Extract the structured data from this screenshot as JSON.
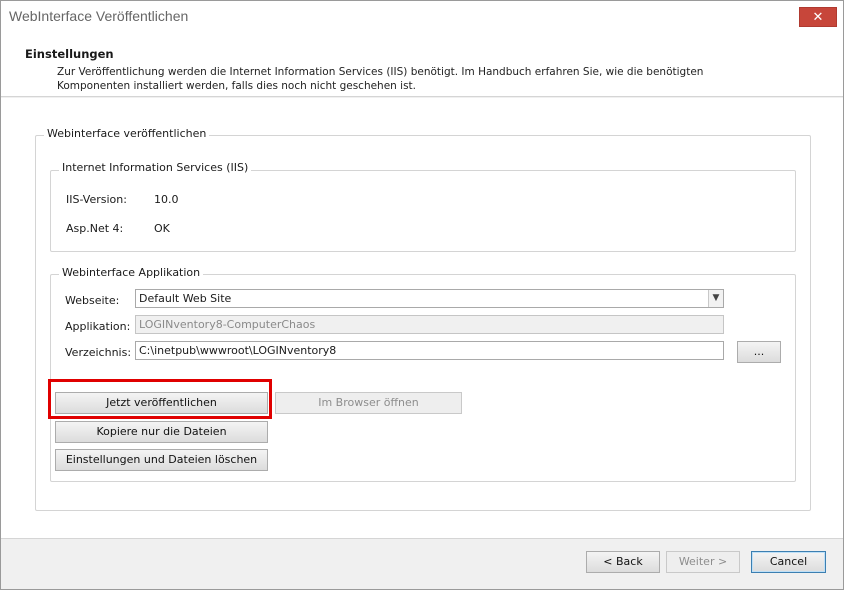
{
  "window": {
    "title": "WebInterface Veröffentlichen",
    "close_label": "✕"
  },
  "header": {
    "title": "Einstellungen",
    "description": "Zur Veröffentlichung werden die Internet Information Services (IIS) benötigt. Im Handbuch erfahren Sie, wie die benötigten Komponenten installiert werden, falls dies noch nicht geschehen ist."
  },
  "publish_group": {
    "legend": "Webinterface veröffentlichen",
    "iis": {
      "legend": "Internet Information Services (IIS)",
      "version_label": "IIS-Version:",
      "version_value": "10.0",
      "aspnet_label": "Asp.Net 4:",
      "aspnet_value": "OK"
    },
    "app": {
      "legend": "Webinterface Applikation",
      "website_label": "Webseite:",
      "website_value": "Default Web Site",
      "application_label": "Applikation:",
      "application_value": "LOGINventory8-ComputerChaos",
      "directory_label": "Verzeichnis:",
      "directory_value": "C:\\inetpub\\wwwroot\\LOGINventory8",
      "browse_label": "..."
    },
    "actions": {
      "publish_now": "Jetzt veröffentlichen",
      "open_browser": "Im Browser öffnen",
      "copy_files": "Kopiere nur die Dateien",
      "delete_settings": "Einstellungen und Dateien löschen"
    }
  },
  "footer": {
    "back": "< Back",
    "next": "Weiter >",
    "cancel": "Cancel"
  },
  "colors": {
    "highlight": "#e00000",
    "close_button": "#c7463a"
  }
}
